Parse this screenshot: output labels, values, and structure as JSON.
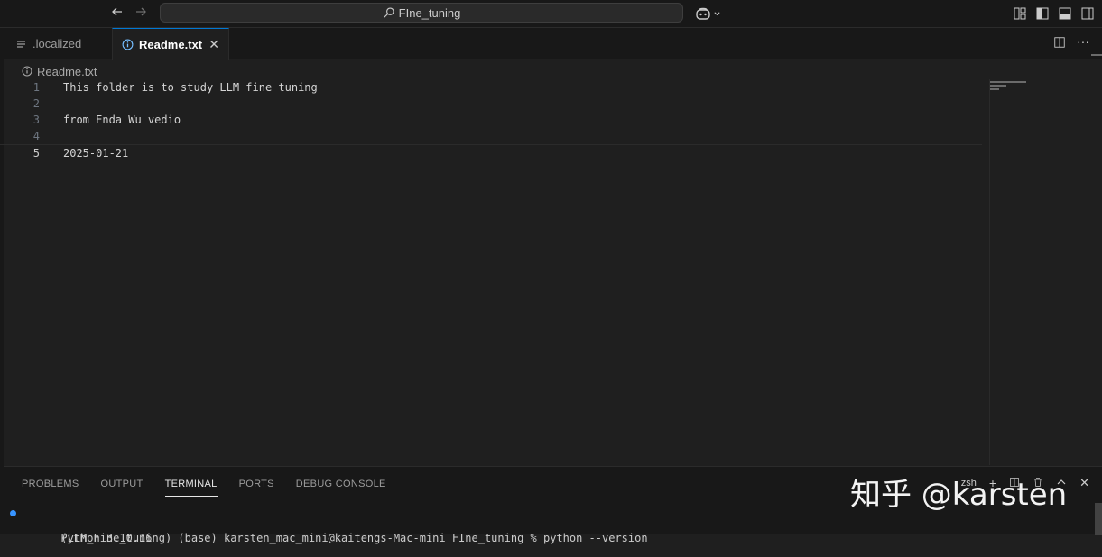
{
  "titlebar": {
    "search_text": "FIne_tuning",
    "back_icon": "arrow-left-icon",
    "forward_icon": "arrow-right-icon"
  },
  "tabs": [
    {
      "label": ".localized",
      "icon": "lines-icon",
      "active": false
    },
    {
      "label": "Readme.txt",
      "icon": "info-icon",
      "active": true
    }
  ],
  "breadcrumb": {
    "file": "Readme.txt"
  },
  "editor": {
    "lines": [
      {
        "num": "1",
        "text": "This folder is to study LLM fine tuning"
      },
      {
        "num": "2",
        "text": ""
      },
      {
        "num": "3",
        "text": "from Enda Wu vedio"
      },
      {
        "num": "4",
        "text": ""
      },
      {
        "num": "5",
        "text": "2025-01-21"
      }
    ],
    "current_line": 5
  },
  "panel": {
    "tabs": [
      "PROBLEMS",
      "OUTPUT",
      "TERMINAL",
      "PORTS",
      "DEBUG CONSOLE"
    ],
    "active_tab": "TERMINAL",
    "shell": "zsh",
    "terminal_lines": [
      "(LLM_Fine_tuning) (base) karsten_mac_mini@kaitengs-Mac-mini FIne_tuning % python --version",
      "Python 3.10.16"
    ]
  },
  "watermark": "知乎 @karsten",
  "colors": {
    "accent": "#0078d4",
    "editor_bg": "#1f1f1f",
    "chrome_bg": "#181818"
  }
}
